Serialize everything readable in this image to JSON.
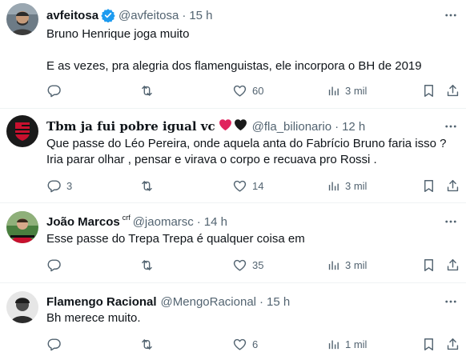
{
  "tweets": [
    {
      "name": "avfeitosa",
      "handle": "@avfeitosa",
      "time": "15 h",
      "lines": [
        "Bruno Henrique joga muito",
        "",
        "E as vezes, pra alegria dos flamenguistas, ele incorpora o BH de 2019"
      ],
      "replies": "",
      "reposts": "",
      "likes": "60",
      "views": "3 mil"
    },
    {
      "name": "Tbm ja fui pobre igual vc",
      "handle": "@fla_bilionario",
      "time": "12 h",
      "lines": [
        "Que passe do Léo Pereira, onde aquela anta do Fabrício Bruno faria isso ?",
        "Iria parar olhar , pensar e virava o corpo e recuava pro Rossi ."
      ],
      "replies": "3",
      "reposts": "",
      "likes": "14",
      "views": "3 mil"
    },
    {
      "name": "João Marcos",
      "badge": "crf",
      "handle": "@jaomarsc",
      "time": "14 h",
      "lines": [
        "Esse passe do Trepa Trepa é qualquer coisa em"
      ],
      "replies": "",
      "reposts": "",
      "likes": "35",
      "views": "3 mil"
    },
    {
      "name": "Flamengo Racional",
      "handle": "@MengoRacional",
      "time": "15 h",
      "lines": [
        "Bh merece muito."
      ],
      "replies": "",
      "reposts": "",
      "likes": "6",
      "views": "1 mil"
    }
  ],
  "icons": {
    "reply": "reply-icon",
    "repost": "repost-icon",
    "like": "heart-icon",
    "views": "views-icon",
    "bookmark": "bookmark-icon",
    "share": "share-icon",
    "more": "more-icon",
    "verified": "verified-badge-icon"
  },
  "colors": {
    "text": "#0f1419",
    "secondary": "#536471",
    "divider": "#eff3f4",
    "verified": "#1d9bf0",
    "flamengo_red": "#c8102e"
  }
}
